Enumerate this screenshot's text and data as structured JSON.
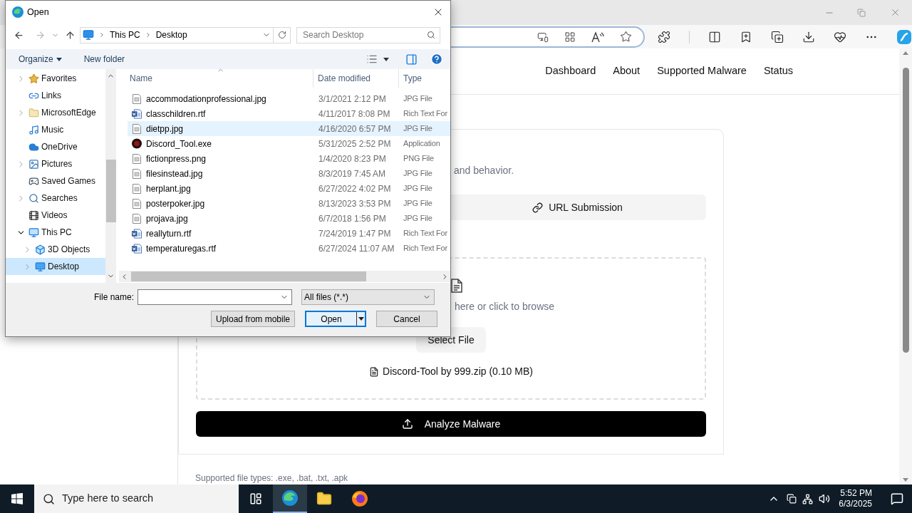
{
  "browser": {
    "nav_links": [
      "Dashboard",
      "About",
      "Supported Malware",
      "Status"
    ],
    "intro_tail": "and behavior.",
    "tabs": [
      {
        "label": "URL Submission",
        "selected": false
      }
    ],
    "drop_hint": "here or click to browse",
    "select_button": "Select File",
    "selected_file": "Discord-Tool by 999.zip (0.10 MB)",
    "analyze_button": "Analyze Malware",
    "footer": "Supported file types: .exe, .bat, .txt, .apk"
  },
  "dialog": {
    "title": "Open",
    "path": [
      "This PC",
      "Desktop"
    ],
    "search_placeholder": "Search Desktop",
    "toolbar": [
      "Organize",
      "New folder"
    ],
    "nav_tree": [
      {
        "label": "Favorites",
        "kind": "star",
        "expandable": true,
        "expanded": false,
        "selected": false
      },
      {
        "label": "Links",
        "kind": "link",
        "expandable": false,
        "selected": false
      },
      {
        "label": "MicrosoftEdge",
        "kind": "folder",
        "expandable": true,
        "expanded": false,
        "selected": false
      },
      {
        "label": "Music",
        "kind": "music",
        "expandable": false,
        "selected": false
      },
      {
        "label": "OneDrive",
        "kind": "cloud",
        "expandable": false,
        "selected": false
      },
      {
        "label": "Pictures",
        "kind": "pictures",
        "expandable": true,
        "expanded": false,
        "selected": false
      },
      {
        "label": "Saved Games",
        "kind": "games",
        "expandable": false,
        "selected": false
      },
      {
        "label": "Searches",
        "kind": "search",
        "expandable": true,
        "expanded": false,
        "selected": false
      },
      {
        "label": "Videos",
        "kind": "videos",
        "expandable": false,
        "selected": false
      },
      {
        "label": "This PC",
        "kind": "pc",
        "expandable": true,
        "expanded": true,
        "selected": false,
        "children": [
          {
            "label": "3D Objects",
            "kind": "cube",
            "expandable": true,
            "expanded": false,
            "selected": false
          },
          {
            "label": "Desktop",
            "kind": "desktop",
            "expandable": true,
            "expanded": false,
            "selected": true
          }
        ]
      }
    ],
    "columns": [
      "Name",
      "Date modified",
      "Type"
    ],
    "files": [
      {
        "name": "accommodationprofessional.jpg",
        "date": "3/1/2021 2:12 PM",
        "type": "JPG File",
        "kind": "image",
        "selected": false
      },
      {
        "name": "classchildren.rtf",
        "date": "4/11/2017 8:08 PM",
        "type": "Rich Text For",
        "kind": "document",
        "selected": false
      },
      {
        "name": "dietpp.jpg",
        "date": "4/16/2020 6:57 PM",
        "type": "JPG File",
        "kind": "image",
        "selected": true
      },
      {
        "name": "Discord_Tool.exe",
        "date": "5/31/2025 2:52 PM",
        "type": "Application",
        "kind": "app",
        "selected": false
      },
      {
        "name": "fictionpress.png",
        "date": "1/4/2020 8:23 PM",
        "type": "PNG File",
        "kind": "image",
        "selected": false
      },
      {
        "name": "filesinstead.jpg",
        "date": "8/3/2019 7:45 AM",
        "type": "JPG File",
        "kind": "image",
        "selected": false
      },
      {
        "name": "herplant.jpg",
        "date": "6/27/2022 4:02 PM",
        "type": "JPG File",
        "kind": "image",
        "selected": false
      },
      {
        "name": "posterpoker.jpg",
        "date": "8/13/2023 3:53 PM",
        "type": "JPG File",
        "kind": "image",
        "selected": false
      },
      {
        "name": "projava.jpg",
        "date": "6/7/2018 1:56 PM",
        "type": "JPG File",
        "kind": "image",
        "selected": false
      },
      {
        "name": "reallyturn.rtf",
        "date": "7/24/2019 1:47 PM",
        "type": "Rich Text For",
        "kind": "document",
        "selected": false
      },
      {
        "name": "temperaturegas.rtf",
        "date": "6/27/2024 11:07 AM",
        "type": "Rich Text For",
        "kind": "document",
        "selected": false
      }
    ],
    "file_name_label": "File name:",
    "file_type": "All files (*.*)",
    "buttons": [
      "Upload from mobile",
      "Open",
      "Cancel"
    ]
  },
  "taskbar": {
    "search_placeholder": "Type here to search",
    "time": "5:52 PM",
    "date": "6/3/2025"
  }
}
